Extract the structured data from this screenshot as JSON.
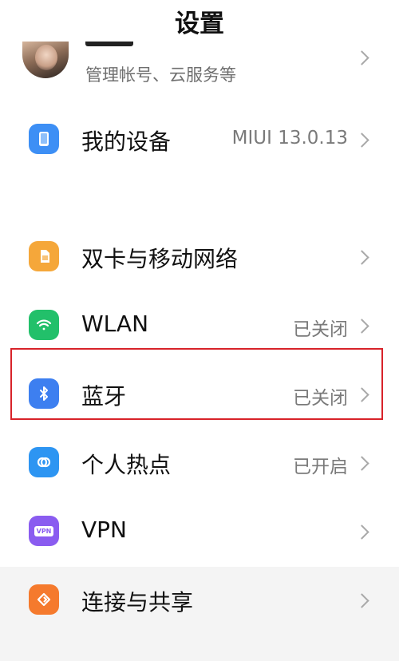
{
  "header": {
    "title": "设置"
  },
  "account": {
    "subtitle": "管理帐号、云服务等"
  },
  "rows": [
    {
      "label": "我的设备",
      "value": "MIUI 13.0.13",
      "icon": "phone-icon",
      "color": "#3d8ff5"
    },
    {
      "label": "双卡与移动网络",
      "value": "",
      "icon": "sim-card-icon",
      "color": "#f5a73a"
    },
    {
      "label": "WLAN",
      "value": "已关闭",
      "icon": "wifi-icon",
      "color": "#22c06a"
    },
    {
      "label": "蓝牙",
      "value": "已关闭",
      "icon": "bluetooth-icon",
      "color": "#3d7ff0"
    },
    {
      "label": "个人热点",
      "value": "已开启",
      "icon": "hotspot-icon",
      "color": "#2d95f2"
    },
    {
      "label": "VPN",
      "value": "",
      "icon": "vpn-icon",
      "color": "#8a5cf0"
    },
    {
      "label": "连接与共享",
      "value": "",
      "icon": "connection-share-icon",
      "color": "#f57a2d"
    }
  ],
  "vpn_icon_text": "VPN",
  "highlight_color": "#d8232a"
}
